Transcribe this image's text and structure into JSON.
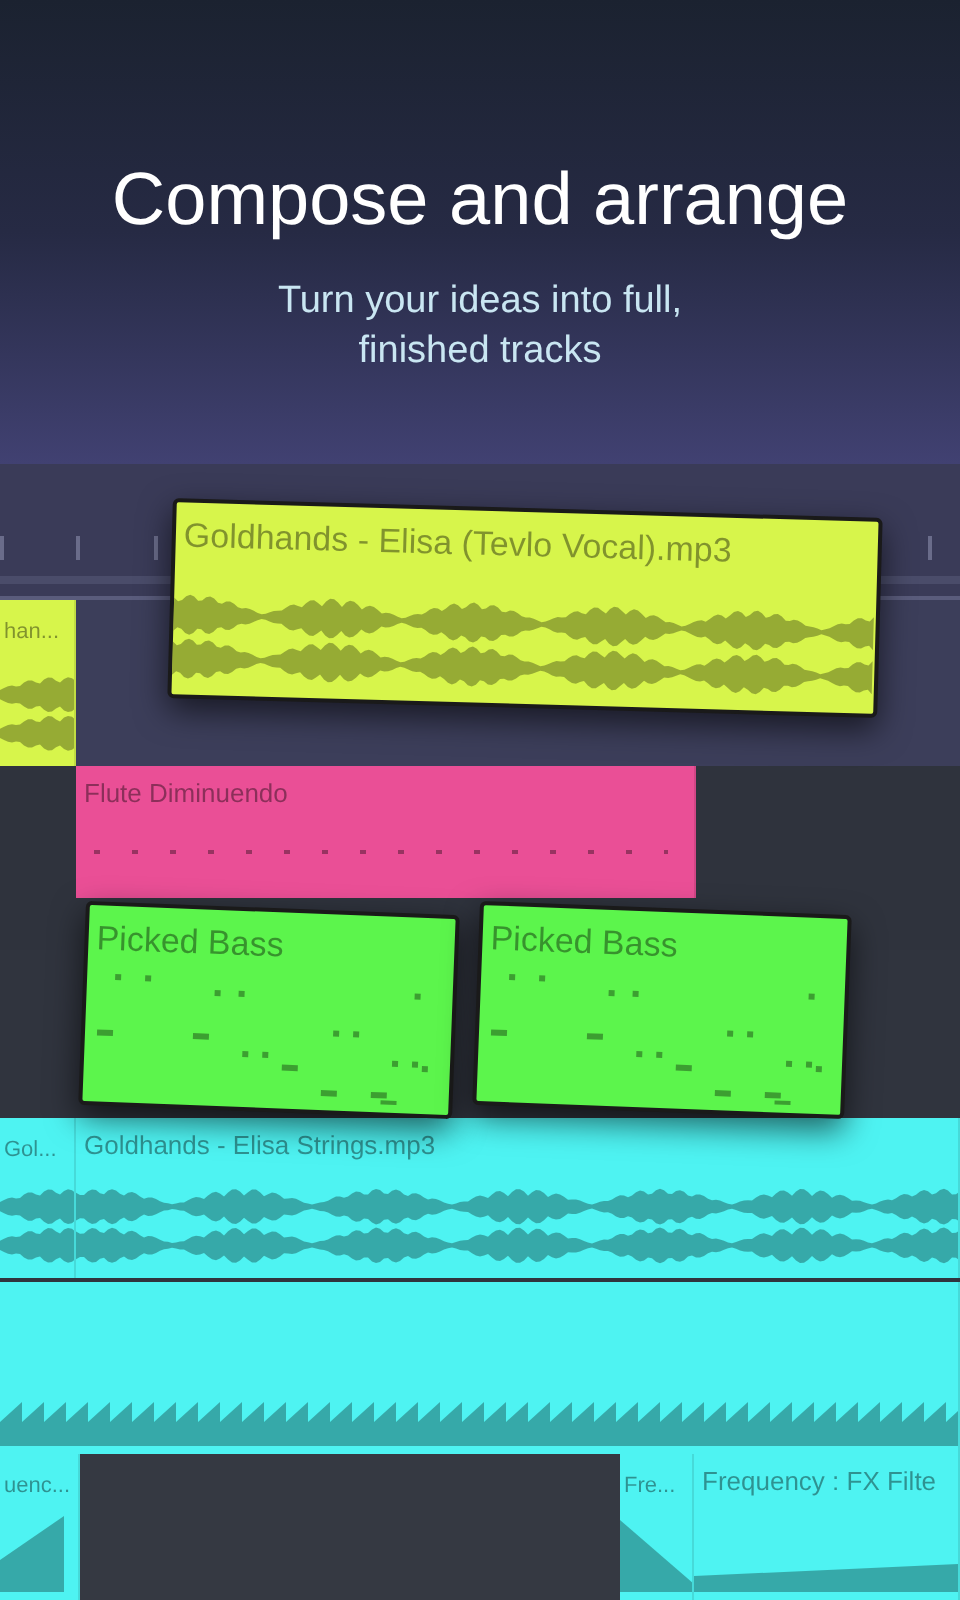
{
  "header": {
    "title": "Compose and arrange",
    "subtitle": "Turn your ideas into full,\nfinished tracks"
  },
  "tracks": [
    {
      "clips": [
        {
          "kind": "audio",
          "title": "han...",
          "color": "#d7f54b"
        }
      ]
    },
    {
      "clips": [
        {
          "kind": "notes",
          "title": "Flute Diminuendo",
          "color": "#ea4f96"
        }
      ]
    },
    {
      "clips": [
        {
          "kind": "audio",
          "title": "Gol...",
          "color": "#4ef3f2"
        },
        {
          "kind": "audio",
          "title": "Goldhands - Elisa Strings.mp3",
          "color": "#4ef3f2"
        }
      ]
    },
    {
      "clips": [
        {
          "kind": "automation",
          "color": "#4ef3f2"
        }
      ]
    },
    {
      "clips": [
        {
          "kind": "ramp-up",
          "title": "uenc...",
          "color": "#4ef3f2"
        },
        {
          "kind": "ramp-down",
          "title": "Fre...",
          "color": "#4ef3f2"
        },
        {
          "kind": "ramp-flat",
          "title": "Frequency : FX Filte",
          "color": "#4ef3f2"
        }
      ]
    }
  ],
  "dragged_clips": [
    {
      "kind": "audio",
      "title": "Goldhands - Elisa (Tevlo Vocal).mp3",
      "color": "#d7f54b"
    },
    {
      "kind": "notes",
      "title": "Picked Bass",
      "color": "#5cf54c"
    },
    {
      "kind": "notes",
      "title": "Picked Bass",
      "color": "#5cf54c"
    }
  ]
}
